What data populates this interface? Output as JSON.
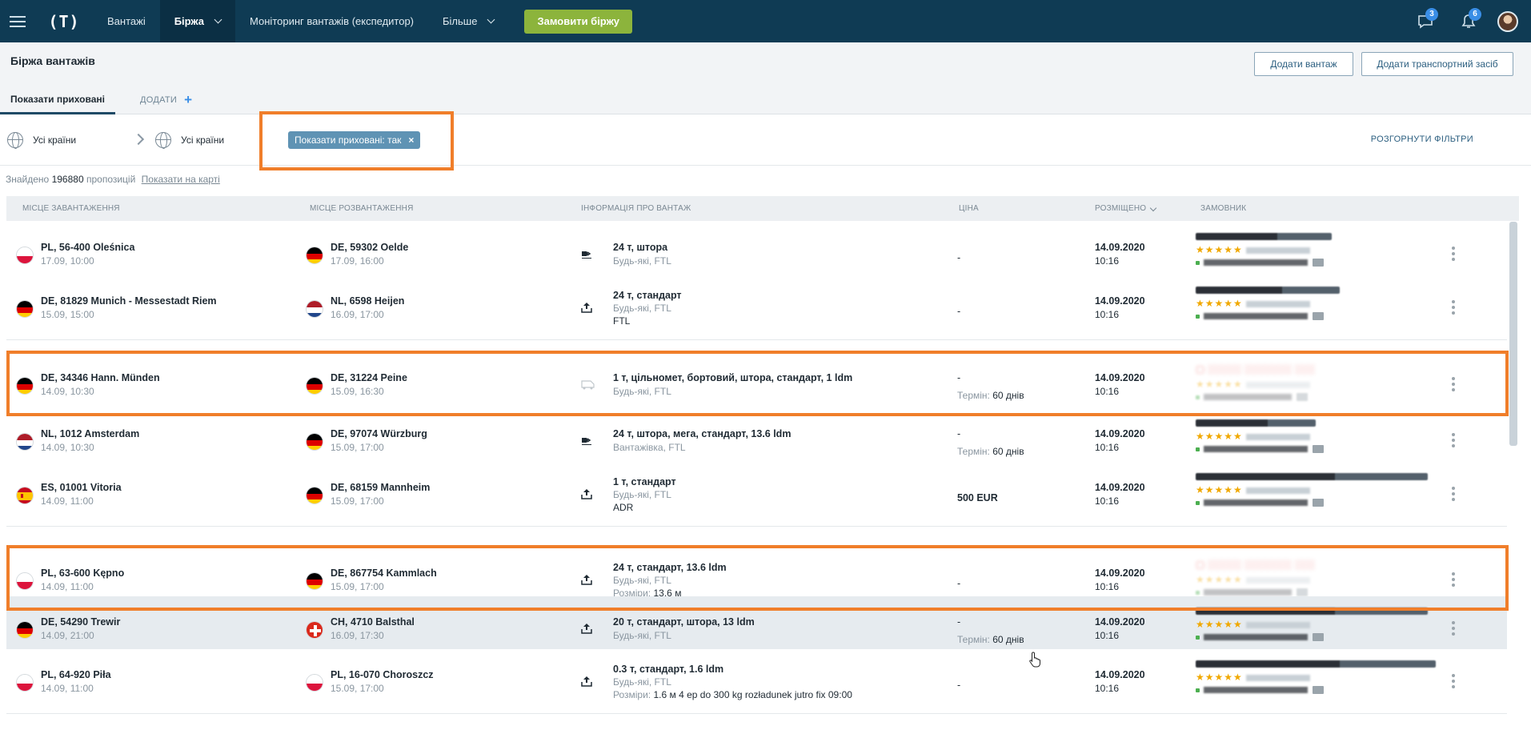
{
  "nav": {
    "logo": "(T)",
    "items": [
      {
        "label": "Вантажі"
      },
      {
        "label": "Біржа"
      },
      {
        "label": "Моніторинг вантажів (експедитор)"
      },
      {
        "label": "Більше"
      }
    ],
    "order_button": "Замовити біржу",
    "chat_badge": "3",
    "notif_badge": "6"
  },
  "header": {
    "title": "Біржа вантажів",
    "add_cargo": "Додати вантаж",
    "add_vehicle": "Додати транспортний засіб",
    "tab_hidden": "Показати приховані",
    "tab_add": "ДОДАТИ"
  },
  "filters": {
    "from_country": "Усі країни",
    "to_country": "Усі країни",
    "chip": "Показати приховані: так",
    "expand": "РОЗГОРНУТИ ФІЛЬТРИ"
  },
  "results": {
    "found_prefix": "Знайдено",
    "count": "196880",
    "found_suffix": "пропозицій",
    "map_link": "Показати на карті"
  },
  "columns": {
    "loading": "МІСЦЕ ЗАВАНТАЖЕННЯ",
    "unloading": "МІСЦЕ РОЗВАНТАЖЕННЯ",
    "info": "ІНФОРМАЦІЯ ПРО ВАНТАЖ",
    "price": "ЦІНА",
    "posted": "РОЗМІЩЕНО",
    "customer": "ЗАМОВНИК"
  },
  "rows": [
    {
      "from_flag": "PL",
      "from": "PL, 56-400 Oleśnica",
      "from_date": "17.09, 10:00",
      "to_flag": "DE",
      "to": "DE, 59302 Oelde",
      "to_date": "17.09, 16:00",
      "cargo": "24 т, штора",
      "sub": "Будь-які, FTL",
      "extra": "",
      "price": "-",
      "term_label": "",
      "term_value": "",
      "posted_date": "14.09.2020",
      "posted_time": "10:16",
      "icon": "truck-side-icon"
    },
    {
      "from_flag": "DE",
      "from": "DE, 81829 Munich - Messestadt Riem",
      "from_date": "15.09, 15:00",
      "to_flag": "NL",
      "to": "NL, 6598 Heijen",
      "to_date": "16.09, 17:00",
      "cargo": "24 т, стандарт",
      "sub": "Будь-які, FTL",
      "extra": "FTL",
      "price": "-",
      "term_label": "",
      "term_value": "",
      "posted_date": "14.09.2020",
      "posted_time": "10:16",
      "icon": "upload-icon"
    },
    {
      "from_flag": "DE",
      "from": "DE, 34346 Hann. Münden",
      "from_date": "14.09, 10:30",
      "to_flag": "DE",
      "to": "DE, 31224 Peine",
      "to_date": "15.09, 16:30",
      "cargo": "1 т, цільномет, бортовий, штора, стандарт, 1 ldm",
      "sub": "Будь-які, FTL",
      "extra": "",
      "price": "-",
      "term_label": "Термін:",
      "term_value": "60 днів",
      "posted_date": "14.09.2020",
      "posted_time": "10:16",
      "icon": "van-icon"
    },
    {
      "from_flag": "NL",
      "from": "NL, 1012 Amsterdam",
      "from_date": "14.09, 10:30",
      "to_flag": "DE",
      "to": "DE, 97074 Würzburg",
      "to_date": "15.09, 17:00",
      "cargo": "24 т, штора, мега, стандарт, 13.6 ldm",
      "sub": "Вантажівка, FTL",
      "extra": "",
      "price": "-",
      "term_label": "Термін:",
      "term_value": "60 днів",
      "posted_date": "14.09.2020",
      "posted_time": "10:16",
      "icon": "truck-side-icon"
    },
    {
      "from_flag": "ES",
      "from": "ES, 01001 Vitoria",
      "from_date": "14.09, 11:00",
      "to_flag": "DE",
      "to": "DE, 68159 Mannheim",
      "to_date": "15.09, 17:00",
      "cargo": "1 т, стандарт",
      "sub": "Будь-які, FTL",
      "extra": "ADR",
      "price": "500 EUR",
      "term_label": "",
      "term_value": "",
      "posted_date": "14.09.2020",
      "posted_time": "10:16",
      "icon": "upload-icon"
    },
    {
      "from_flag": "PL",
      "from": "PL, 63-600 Kępno",
      "from_date": "14.09, 11:00",
      "to_flag": "DE",
      "to": "DE, 867754 Kammlach",
      "to_date": "15.09, 17:00",
      "cargo": "24 т, стандарт, 13.6 ldm",
      "sub": "Будь-які, FTL",
      "extra_label": "Розміри:",
      "extra": "13.6 м",
      "price": "-",
      "term_label": "",
      "term_value": "",
      "posted_date": "14.09.2020",
      "posted_time": "10:16",
      "icon": "upload-icon"
    },
    {
      "from_flag": "DE",
      "from": "DE, 54290 Trewir",
      "from_date": "14.09, 21:00",
      "to_flag": "CH",
      "to": "CH, 4710 Balsthal",
      "to_date": "16.09, 17:30",
      "cargo": "20 т, стандарт, штора, 13 ldm",
      "sub": "Будь-які, FTL",
      "extra": "",
      "price": "-",
      "term_label": "Термін:",
      "term_value": "60 днів",
      "posted_date": "14.09.2020",
      "posted_time": "10:16",
      "icon": "upload-icon"
    },
    {
      "from_flag": "PL",
      "from": "PL, 64-920 Piła",
      "from_date": "14.09, 11:00",
      "to_flag": "PL",
      "to": "PL, 16-070 Choroszcz",
      "to_date": "15.09, 17:00",
      "cargo": "0.3 т, стандарт, 1.6 ldm",
      "sub": "Будь-які, FTL",
      "extra_label": "Розміри:",
      "extra": "1.6 м 4 ep do 300 kg rozładunek jutro fix 09:00",
      "price": "-",
      "term_label": "",
      "term_value": "",
      "posted_date": "14.09.2020",
      "posted_time": "10:16",
      "icon": "upload-icon"
    }
  ],
  "colors": {
    "nav_bg": "#0f3b54",
    "accent_green": "#8cb43c",
    "highlight": "#f07e2a",
    "chip": "#5f93b4"
  }
}
